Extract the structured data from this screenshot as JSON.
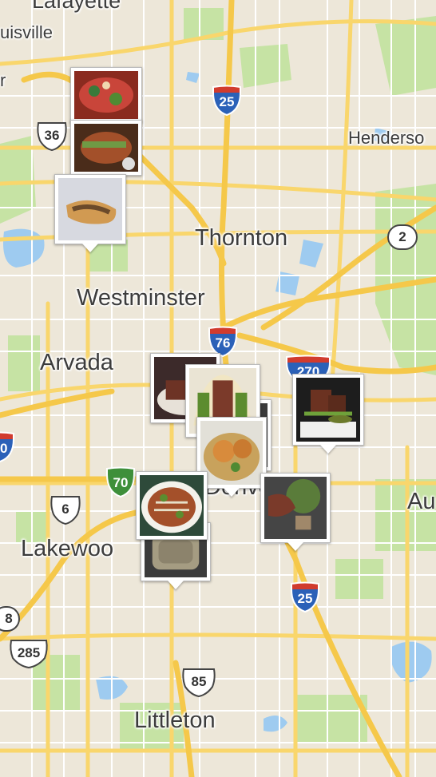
{
  "map": {
    "places": {
      "lafayette": "Lafayette",
      "louisville": "uisville",
      "broomfield_edge": "r",
      "henderson": "Henderso",
      "thornton": "Thornton",
      "westminster": "Westminster",
      "arvada": "Arvada",
      "denver": "Denver",
      "lakewood": "Lakewoo",
      "aurora": "Au",
      "littleton": "Littleton"
    },
    "routes": {
      "i25_north": "25",
      "i25_south": "25",
      "i76": "76",
      "i270": "270",
      "i70": "70",
      "i70_west": "0",
      "us36": "36",
      "us6": "6",
      "us85": "85",
      "us285": "285",
      "hwy2": "2",
      "hwy8": "8"
    },
    "pins_count": 11,
    "colors": {
      "land": "#ede7d9",
      "park": "#c6e3a4",
      "water": "#9ecbf0",
      "major_road": "#f9d66c",
      "minor_road": "#ffffff",
      "interstate_blue": "#2b61b8",
      "interstate_red": "#d13b2e",
      "interstate_green": "#3e8f3a"
    }
  }
}
